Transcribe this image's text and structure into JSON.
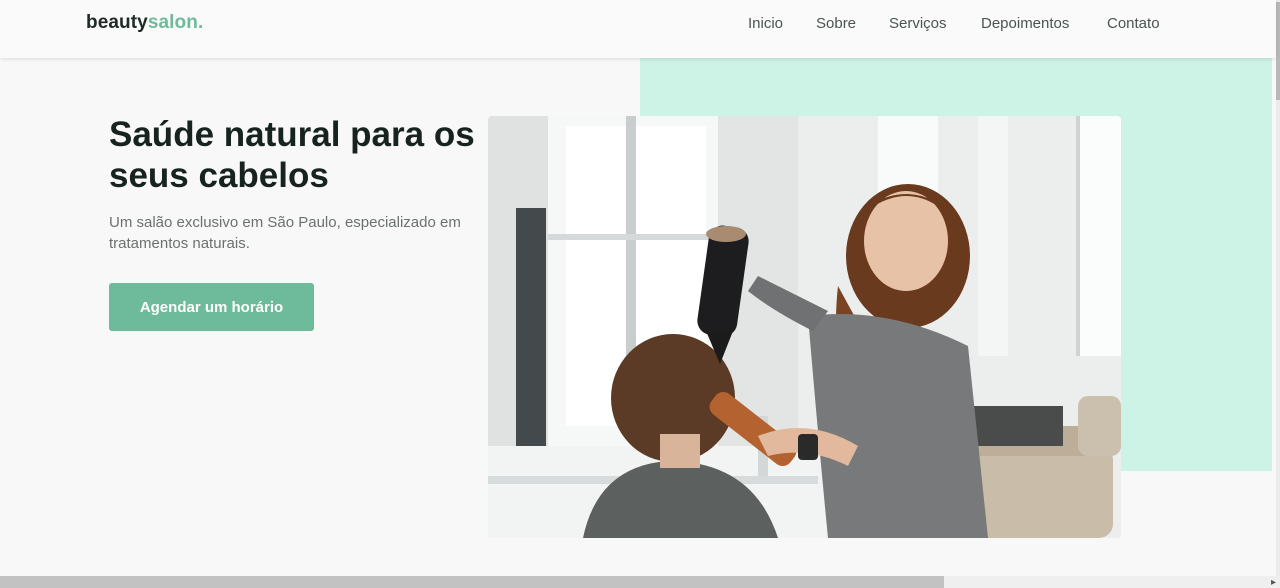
{
  "brand": {
    "logo_part1": "beauty",
    "logo_part2": "salon.",
    "accent_color": "#6dbb9a",
    "mint_color": "#cdf3e6"
  },
  "nav": {
    "items": [
      "Inicio",
      "Sobre",
      "Serviços",
      "Depoimentos",
      "Contato"
    ]
  },
  "hero": {
    "title": "Saúde natural para os seus cabelos",
    "subtitle": "Um salão exclusivo em São Paulo, especializado em tratamentos naturais.",
    "cta_label": "Agendar um horário"
  },
  "icons": {
    "scroll_right": "chevron-right-icon"
  }
}
